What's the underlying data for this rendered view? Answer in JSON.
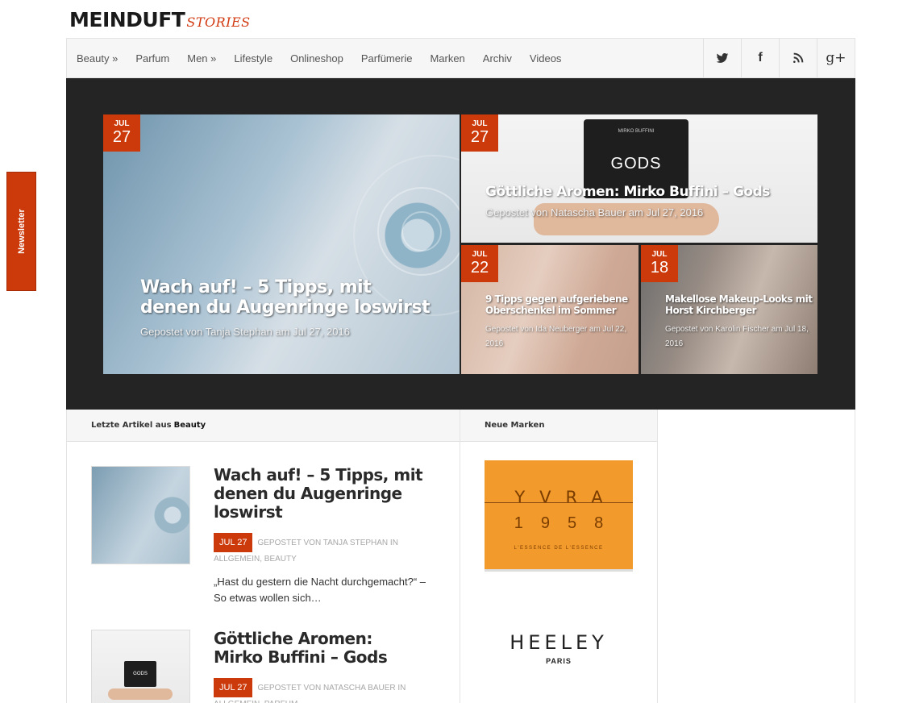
{
  "logo": {
    "main": "MEINDUFT",
    "sub": "STORIES"
  },
  "nav": {
    "items": [
      {
        "label": "Beauty »"
      },
      {
        "label": "Parfum"
      },
      {
        "label": "Men »"
      },
      {
        "label": "Lifestyle"
      },
      {
        "label": "Onlineshop"
      },
      {
        "label": "Parfümerie"
      },
      {
        "label": "Marken"
      },
      {
        "label": "Archiv"
      },
      {
        "label": "Videos"
      }
    ],
    "social": [
      {
        "icon": "twitter-icon"
      },
      {
        "icon": "facebook-icon",
        "glyph": "f"
      },
      {
        "icon": "rss-icon"
      },
      {
        "icon": "google-plus-icon",
        "glyph": "g+"
      }
    ]
  },
  "newsletter": {
    "label": "Newsletter"
  },
  "featured": [
    {
      "month": "JUL",
      "day": "27",
      "title": "Wach auf! – 5 Tipps, mit denen du Augenringe loswirst",
      "meta": "Gepostet von Tanja Stephan am Jul 27, 2016"
    },
    {
      "month": "JUL",
      "day": "27",
      "title": "Göttliche Aromen: Mirko Buffini – Gods",
      "meta": "Gepostet von Natascha Bauer am Jul 27, 2016",
      "product_brand": "MIRKO BUFFINI",
      "product_name": "GODS"
    },
    {
      "month": "JUL",
      "day": "22",
      "title": "9 Tipps gegen aufgeriebene Oberschenkel im Sommer",
      "meta": "Gepostet von Ida Neuberger am Jul 22, 2016"
    },
    {
      "month": "JUL",
      "day": "18",
      "title": "Makellose Makeup-Looks mit Horst Kirchberger",
      "meta": "Gepostet von Karolin Fischer am Jul 18, 2016"
    }
  ],
  "latest": {
    "heading_prefix": "Letzte Artikel aus",
    "heading_category": "Beauty",
    "articles": [
      {
        "title": "Wach auf! – 5 Tipps, mit denen du Augenringe loswirst",
        "date": "JUL 27",
        "meta": "GEPOSTET VON TANJA STEPHAN IN ALLGEMEIN, BEAUTY",
        "excerpt": "„Hast du gestern die Nacht durchgemacht?“ – So etwas wollen sich…"
      },
      {
        "title": "Göttliche Aromen: Mirko Buffini – Gods",
        "date": "JUL 27",
        "meta": "GEPOSTET VON NATASCHA BAUER IN ALLGEMEIN, PARFUM",
        "thumb_text": "GODS"
      }
    ]
  },
  "brands": {
    "heading": "Neue Marken",
    "items": [
      {
        "line1": "YVRA",
        "line2": "1958",
        "tagline": "L'ESSENCE DE L'ESSENCE"
      },
      {
        "name": "HEELEY",
        "sub": "PARIS"
      }
    ]
  },
  "colors": {
    "accent": "#cc3a0c",
    "dark_bg": "#242424",
    "nav_bg": "#f6f6f6"
  }
}
